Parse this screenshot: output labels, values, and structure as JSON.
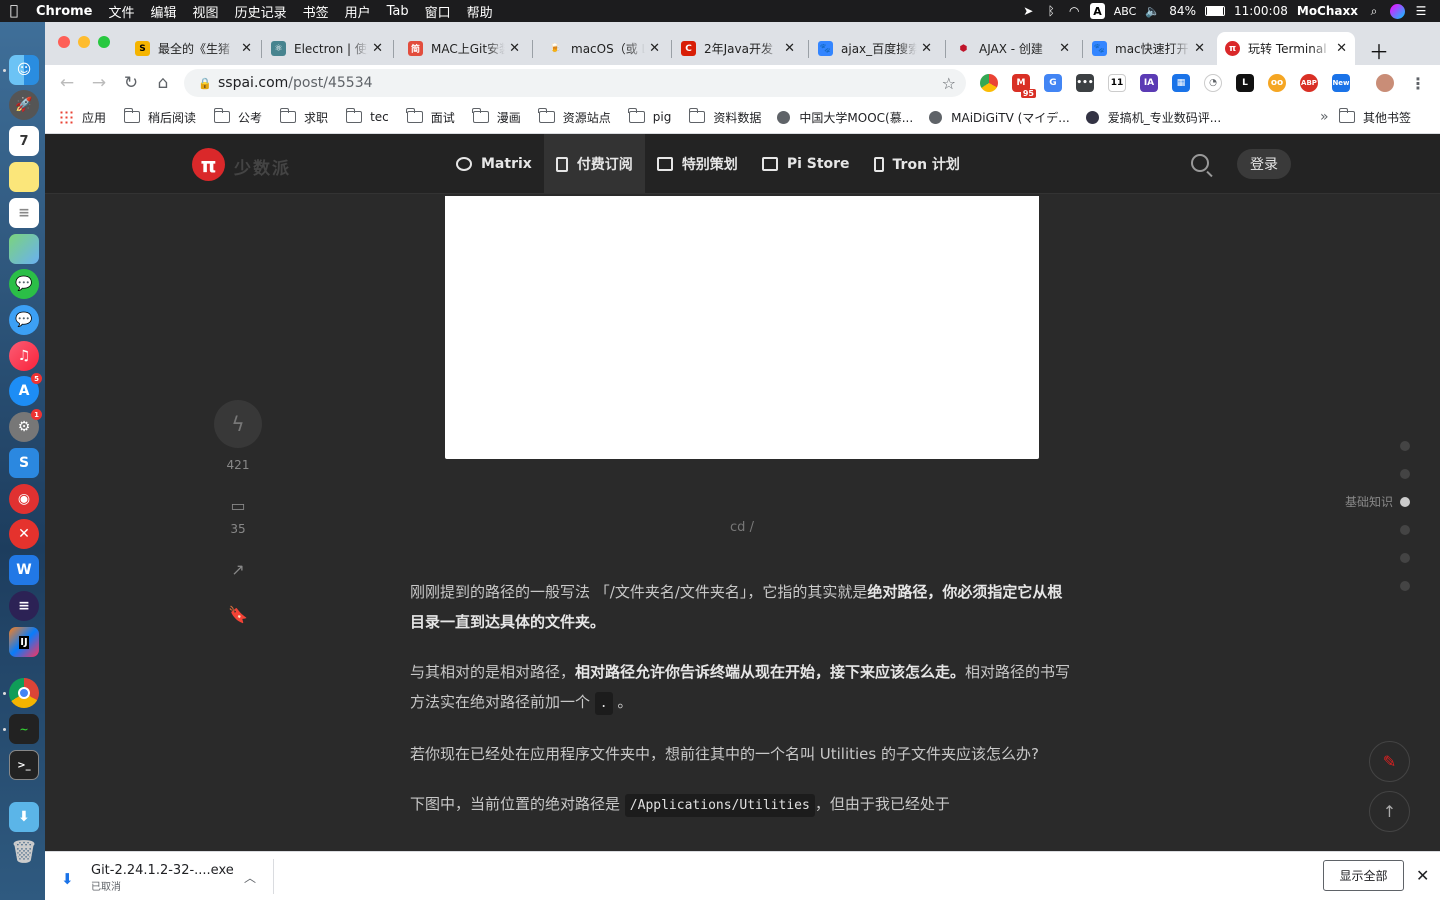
{
  "menubar": {
    "app_name": "Chrome",
    "items": [
      "文件",
      "编辑",
      "视图",
      "历史记录",
      "书签",
      "用户",
      "Tab",
      "窗口",
      "帮助"
    ],
    "ime": "A",
    "ime_label": "ABC",
    "battery": "84%",
    "time": "11:00:08",
    "user": "MoChaxx"
  },
  "dock": {
    "badges": {
      "appstore": "5",
      "sysprefs": "1"
    },
    "ide_label": "IJ"
  },
  "tabs": [
    {
      "title": "最全的《生猪",
      "fav_color": "#f5b400",
      "fav_text": "S"
    },
    {
      "title": "Electron | 使用",
      "fav_color": "#47848f",
      "fav_text": "⚛"
    },
    {
      "title": "MAC上Git安装",
      "fav_color": "#e24d3d",
      "fav_text": "简"
    },
    {
      "title": "macOS（或 L",
      "fav_color": "#f0a020",
      "fav_text": "🍺"
    },
    {
      "title": "2年Java开发",
      "fav_color": "#d81e06",
      "fav_text": "C"
    },
    {
      "title": "ajax_百度搜索",
      "fav_color": "#3385ff",
      "fav_text": "🐾"
    },
    {
      "title": "AJAX - 创建",
      "fav_color": "#c0142a",
      "fav_text": "⬢"
    },
    {
      "title": "mac快速打开",
      "fav_color": "#3385ff",
      "fav_text": "🐾"
    },
    {
      "title": "玩转 Terminal",
      "fav_color": "#da282a",
      "fav_text": "π"
    }
  ],
  "toolbar": {
    "url_host": "sspai.com",
    "url_path": "/post/45534",
    "extensions": [
      {
        "name": "ext-chrome-color",
        "color": "#f4b400",
        "text": ""
      },
      {
        "name": "ext-gmail",
        "color": "#d93025",
        "text": "M"
      },
      {
        "name": "ext-translate",
        "color": "#4285f4",
        "text": "G"
      },
      {
        "name": "ext-more",
        "color": "#3c4043",
        "text": "•••"
      },
      {
        "name": "ext-clock",
        "color": "#fff",
        "text": "11"
      },
      {
        "name": "ext-ia",
        "color": "#5b3bb4",
        "text": "IA"
      },
      {
        "name": "ext-grid",
        "color": "#1a73e8",
        "text": "▦"
      },
      {
        "name": "ext-speed",
        "color": "#5f6368",
        "text": "◔"
      },
      {
        "name": "ext-leet",
        "color": "#111",
        "text": "L"
      },
      {
        "name": "ext-owl",
        "color": "#f5a623",
        "text": "oo"
      },
      {
        "name": "ext-abp",
        "color": "#d93025",
        "text": "ABP"
      },
      {
        "name": "ext-new",
        "color": "#1a73e8",
        "text": "New"
      }
    ],
    "gmail_badge": "95"
  },
  "bookmarks": [
    {
      "label": "应用",
      "icon": "apps-icon"
    },
    {
      "label": "稍后阅读",
      "icon": "folder-icon"
    },
    {
      "label": "公考",
      "icon": "folder-icon"
    },
    {
      "label": "求职",
      "icon": "folder-icon"
    },
    {
      "label": "tec",
      "icon": "folder-icon"
    },
    {
      "label": "面试",
      "icon": "folder-icon"
    },
    {
      "label": "漫画",
      "icon": "folder-icon"
    },
    {
      "label": "资源站点",
      "icon": "folder-icon"
    },
    {
      "label": "pig",
      "icon": "folder-icon"
    },
    {
      "label": "资料数据",
      "icon": "folder-icon"
    },
    {
      "label": "中国大学MOOC(慕...",
      "icon": "globe-icon"
    },
    {
      "label": "MAiDiGiTV (マイデ...",
      "icon": "globe-icon"
    },
    {
      "label": "爱搞机_专业数码评...",
      "icon": "globe-icon"
    }
  ],
  "bookmarks_more": "»",
  "bookmarks_other": "其他书签",
  "site": {
    "logo_text": "少数派",
    "nav": [
      {
        "label": "Matrix",
        "active": false
      },
      {
        "label": "付费订阅",
        "active": true
      },
      {
        "label": "特别策划",
        "active": false
      },
      {
        "label": "Pi Store",
        "active": false
      },
      {
        "label": "Tron 计划",
        "active": false
      }
    ],
    "login_label": "登录"
  },
  "article": {
    "caption": "cd /",
    "like_count": "421",
    "comment_count": "35",
    "toc_active_label": "基础知识",
    "p1_plain": "刚刚提到的路径的一般写法 「/文件夹名/文件夹名」，它指的其实就是",
    "p1_bold": "绝对路径，你必须指定它从根目录一直到达具体的文件夹。",
    "p2_plain": "与其相对的是相对路径，",
    "p2_bold": "相对路径允许你告诉终端从现在开始，接下来应该怎么走。",
    "p2_rest": "相对路径的书写方法实在绝对路径前加一个",
    "p2_code": ".",
    "p2_end": "。",
    "p3": "若你现在已经处在应用程序文件夹中，想前往其中的一个名叫 Utilities 的子文件夹应该怎么办?",
    "p4_plain": "下图中，当前位置的绝对路径是",
    "p4_code": "/Applications/Utilities",
    "p4_rest": "，但由于我已经处于"
  },
  "download": {
    "filename": "Git-2.24.1.2-32-....exe",
    "status": "已取消",
    "show_all": "显示全部"
  }
}
